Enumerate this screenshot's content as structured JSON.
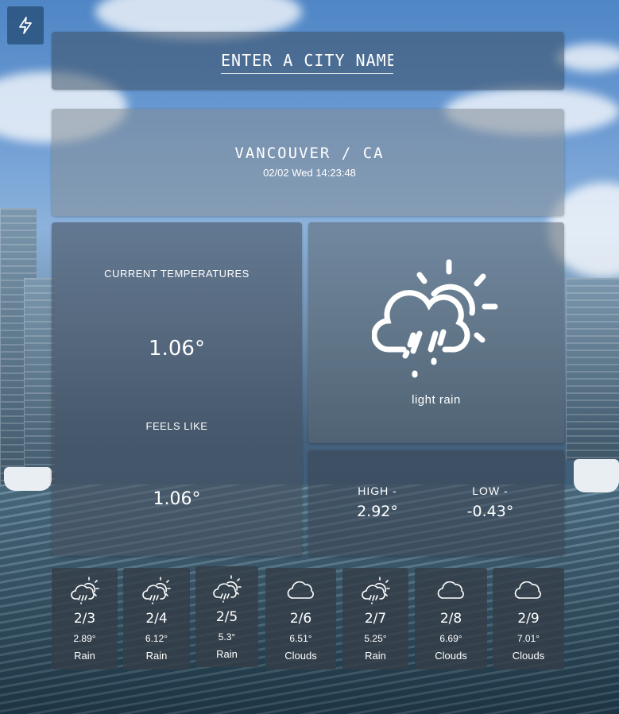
{
  "search": {
    "placeholder": "ENTER A CITY NAME"
  },
  "location": {
    "name": "VANCOUVER / CA",
    "datetime": "02/02 Wed 14:23:48"
  },
  "current": {
    "label": "CURRENT TEMPERATURES",
    "temp": "1.06°",
    "feels_label": "FEELS LIKE",
    "feels_temp": "1.06°"
  },
  "condition": {
    "icon": "sun-cloud-rain-icon",
    "description": "light rain"
  },
  "hilo": {
    "high_label": "HIGH -",
    "high": "2.92°",
    "low_label": "LOW -",
    "low": "-0.43°"
  },
  "forecast": [
    {
      "date": "2/3",
      "temp": "2.89°",
      "condition": "Rain",
      "icon": "sun-cloud-rain-icon"
    },
    {
      "date": "2/4",
      "temp": "6.12°",
      "condition": "Rain",
      "icon": "sun-cloud-rain-icon"
    },
    {
      "date": "2/5",
      "temp": "5.3°",
      "condition": "Rain",
      "icon": "sun-cloud-rain-icon"
    },
    {
      "date": "2/6",
      "temp": "6.51°",
      "condition": "Clouds",
      "icon": "cloud-icon"
    },
    {
      "date": "2/7",
      "temp": "5.25°",
      "condition": "Rain",
      "icon": "sun-cloud-rain-icon"
    },
    {
      "date": "2/8",
      "temp": "6.69°",
      "condition": "Clouds",
      "icon": "cloud-icon"
    },
    {
      "date": "2/9",
      "temp": "7.01°",
      "condition": "Clouds",
      "icon": "cloud-icon"
    }
  ],
  "colors": {
    "panel": "#3c5064",
    "text": "#ffffff",
    "button": "#285078"
  }
}
